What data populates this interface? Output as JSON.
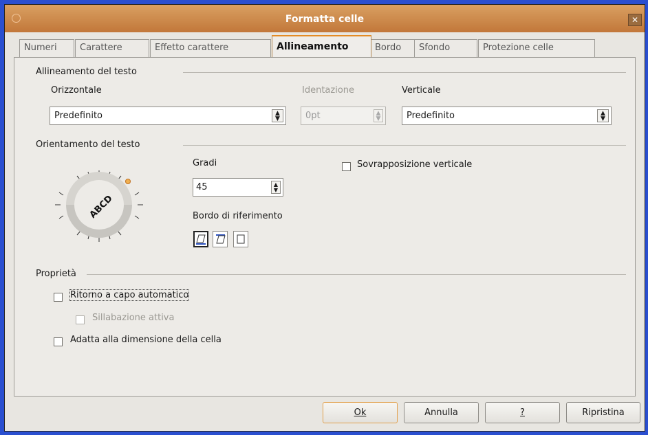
{
  "window": {
    "title": "Formatta celle"
  },
  "tabs": [
    {
      "label": "Numeri"
    },
    {
      "label": "Carattere"
    },
    {
      "label": "Effetto carattere"
    },
    {
      "label": "Allineamento",
      "active": true
    },
    {
      "label": "Bordo"
    },
    {
      "label": "Sfondo"
    },
    {
      "label": "Protezione celle"
    }
  ],
  "text_alignment": {
    "heading": "Allineamento del testo",
    "horizontal": {
      "label": "Orizzontale",
      "value": "Predefinito"
    },
    "indent": {
      "label": "Identazione",
      "value": "0pt"
    },
    "vertical": {
      "label": "Verticale",
      "value": "Predefinito"
    }
  },
  "orientation": {
    "heading": "Orientamento del testo",
    "dial_text": "ABCD",
    "degrees": {
      "label": "Gradi",
      "value": "45"
    },
    "vertical_stacking": {
      "label": "Sovrapposizione verticale",
      "checked": false
    },
    "reference_edge": {
      "label": "Bordo di riferimento",
      "selected_index": 0
    }
  },
  "properties": {
    "heading": "Proprietà",
    "wrap": {
      "label": "Ritorno a capo automatico",
      "checked": false
    },
    "hyphenation": {
      "label": "Sillabazione attiva",
      "checked": false,
      "disabled": true
    },
    "shrink": {
      "label": "Adatta alla dimensione della cella",
      "checked": false
    }
  },
  "buttons": {
    "ok": "Ok",
    "cancel": "Annulla",
    "help": "?",
    "reset": "Ripristina"
  },
  "colors": {
    "desktop": "#2a4fd0",
    "titlebar": "#c98645",
    "accent": "#e48b25"
  }
}
